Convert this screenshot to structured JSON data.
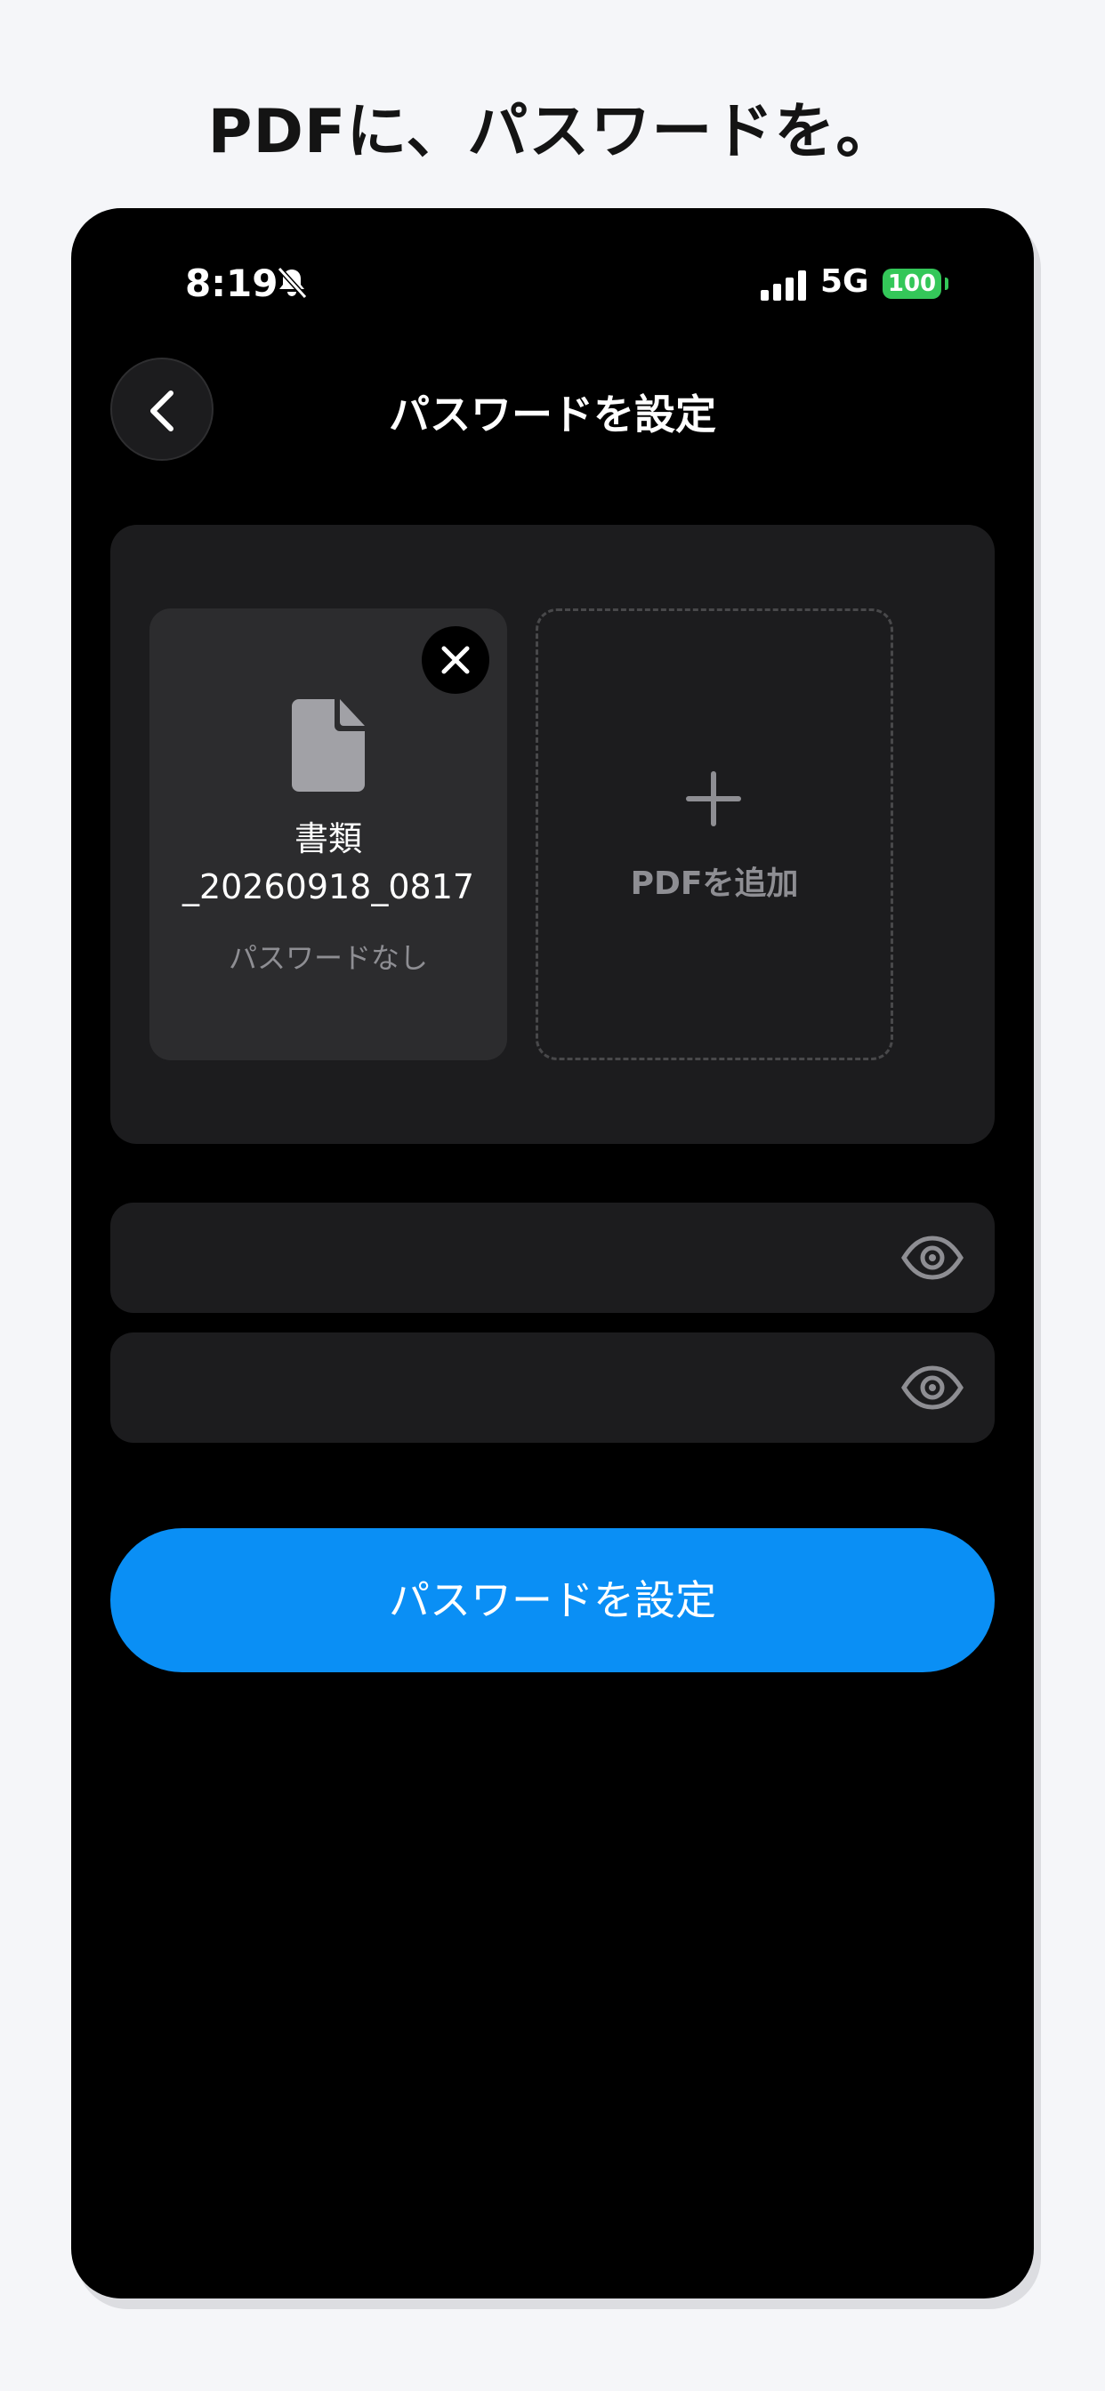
{
  "headline": "PDFに、パスワードを。",
  "status_bar": {
    "time": "8:19",
    "network": "5G",
    "battery": "100",
    "battery_color": "#34c759"
  },
  "nav": {
    "title": "パスワードを設定",
    "back_icon": "chevron-left-icon"
  },
  "files": [
    {
      "name_line1": "書類",
      "name_line2": "_20260918_0817",
      "status": "パスワードなし",
      "icon": "document-icon"
    }
  ],
  "add_pdf": {
    "label": "PDFを追加",
    "icon": "plus-icon"
  },
  "password_fields": [
    {
      "value": "",
      "placeholder": "",
      "icon": "eye-icon"
    },
    {
      "value": "",
      "placeholder": "",
      "icon": "eye-icon"
    }
  ],
  "submit": {
    "label": "パスワードを設定",
    "color": "#0a8ff5"
  }
}
